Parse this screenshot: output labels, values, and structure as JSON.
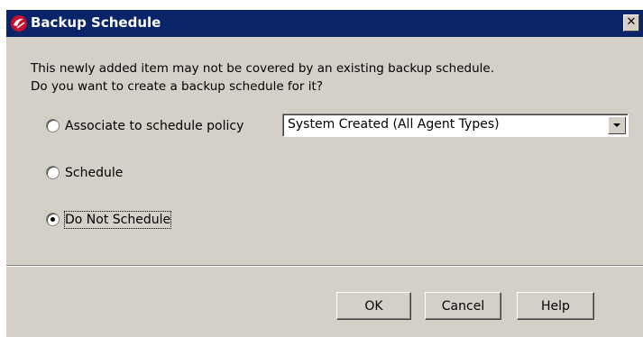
{
  "window": {
    "title": "Backup Schedule",
    "close_symbol": "✕",
    "icon": "app-logo-icon",
    "title_bar_color": "#0a246a"
  },
  "message": {
    "line1": "This newly added item may not be covered by an existing backup schedule.",
    "line2": "Do you want to create a backup schedule for it?"
  },
  "options": [
    {
      "label": "Associate to schedule policy",
      "checked": false
    },
    {
      "label": "Schedule",
      "checked": false
    },
    {
      "label": "Do Not Schedule",
      "checked": true
    }
  ],
  "policy_select": {
    "value": "System Created (All  Agent Types)"
  },
  "buttons": {
    "ok": "OK",
    "cancel": "Cancel",
    "help": "Help"
  }
}
